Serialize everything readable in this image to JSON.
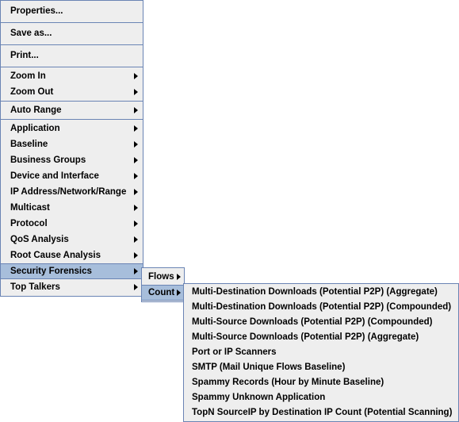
{
  "colors": {
    "menu_background": "#eeeeee",
    "menu_border": "#6a84b4",
    "selection_background": "#a7bedb",
    "separator": "#6a84b4",
    "text": "#000000",
    "page_background": "#ffffff"
  },
  "root_menu": {
    "name": "chart-context-menu",
    "groups": [
      {
        "items": [
          {
            "label": "Properties...",
            "submenu": false,
            "selected": false
          },
          {
            "label": "Save as...",
            "submenu": false,
            "selected": false
          },
          {
            "label": "Print...",
            "submenu": false,
            "selected": false
          }
        ]
      },
      {
        "items": [
          {
            "label": "Zoom In",
            "submenu": true,
            "selected": false
          },
          {
            "label": "Zoom Out",
            "submenu": true,
            "selected": false
          }
        ]
      },
      {
        "items": [
          {
            "label": "Auto Range",
            "submenu": true,
            "selected": false
          }
        ]
      },
      {
        "items": [
          {
            "label": "Application",
            "submenu": true,
            "selected": false
          },
          {
            "label": "Baseline",
            "submenu": true,
            "selected": false
          },
          {
            "label": "Business Groups",
            "submenu": true,
            "selected": false
          },
          {
            "label": "Device and Interface",
            "submenu": true,
            "selected": false
          },
          {
            "label": "IP Address/Network/Range",
            "submenu": true,
            "selected": false
          },
          {
            "label": "Multicast",
            "submenu": true,
            "selected": false
          },
          {
            "label": "Protocol",
            "submenu": true,
            "selected": false
          },
          {
            "label": "QoS Analysis",
            "submenu": true,
            "selected": false
          },
          {
            "label": "Root Cause Analysis",
            "submenu": true,
            "selected": false
          },
          {
            "label": "Security Forensics",
            "submenu": true,
            "selected": true
          },
          {
            "label": "Top Talkers",
            "submenu": true,
            "selected": false
          }
        ]
      }
    ]
  },
  "security_forensics_menu": {
    "name": "security-forensics-submenu",
    "items": [
      {
        "label": "Flows",
        "submenu": true,
        "selected": false
      },
      {
        "label": "Count",
        "submenu": true,
        "selected": true
      }
    ]
  },
  "count_menu": {
    "name": "count-submenu",
    "items": [
      {
        "label": "Multi-Destination Downloads (Potential P2P) (Aggregate)",
        "submenu": false,
        "selected": false
      },
      {
        "label": "Multi-Destination Downloads (Potential P2P) (Compounded)",
        "submenu": false,
        "selected": false
      },
      {
        "label": "Multi-Source Downloads (Potential P2P)  (Compounded)",
        "submenu": false,
        "selected": false
      },
      {
        "label": "Multi-Source Downloads (Potential P2P) (Aggregate)",
        "submenu": false,
        "selected": false
      },
      {
        "label": "Port or IP Scanners",
        "submenu": false,
        "selected": false
      },
      {
        "label": "SMTP (Mail Unique Flows Baseline)",
        "submenu": false,
        "selected": false
      },
      {
        "label": "Spammy Records (Hour by Minute Baseline)",
        "submenu": false,
        "selected": false
      },
      {
        "label": "Spammy Unknown Application",
        "submenu": false,
        "selected": false
      },
      {
        "label": "TopN SourceIP by Destination IP Count (Potential Scanning)",
        "submenu": false,
        "selected": false
      }
    ]
  }
}
